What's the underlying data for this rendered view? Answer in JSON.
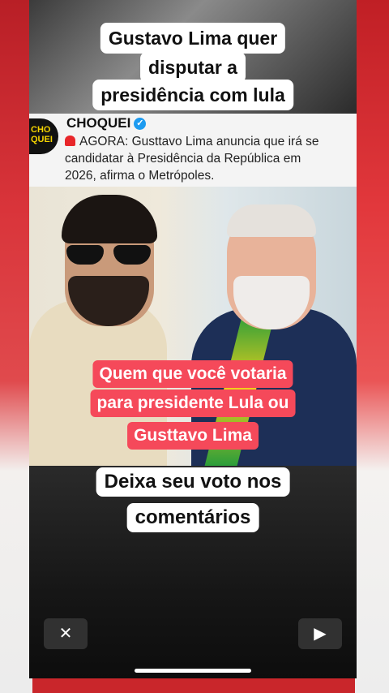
{
  "post": {
    "title_lines": [
      "Gustavo Lima quer",
      "disputar a",
      "presidência com lula"
    ]
  },
  "tweet": {
    "avatar_lines": [
      "CHO",
      "QUEI"
    ],
    "handle": "CHOQUEI",
    "verified_glyph": "✓",
    "text_lines": [
      "AGORA: Gusttavo Lima anuncia que irá se",
      "candidatar à Presidência da República em",
      "2026, afirma o Metrópoles."
    ]
  },
  "overlay_question_lines": [
    "Quem que você votaria",
    "para presidente Lula ou",
    "Gusttavo Lima"
  ],
  "overlay_cta_lines": [
    "Deixa seu voto nos",
    "comentários"
  ],
  "controls": {
    "close_glyph": "✕",
    "play_glyph": "▶"
  },
  "colors": {
    "accent_red": "#f5495a",
    "verified_blue": "#1d9bf0",
    "background_red": "#c9262b"
  }
}
